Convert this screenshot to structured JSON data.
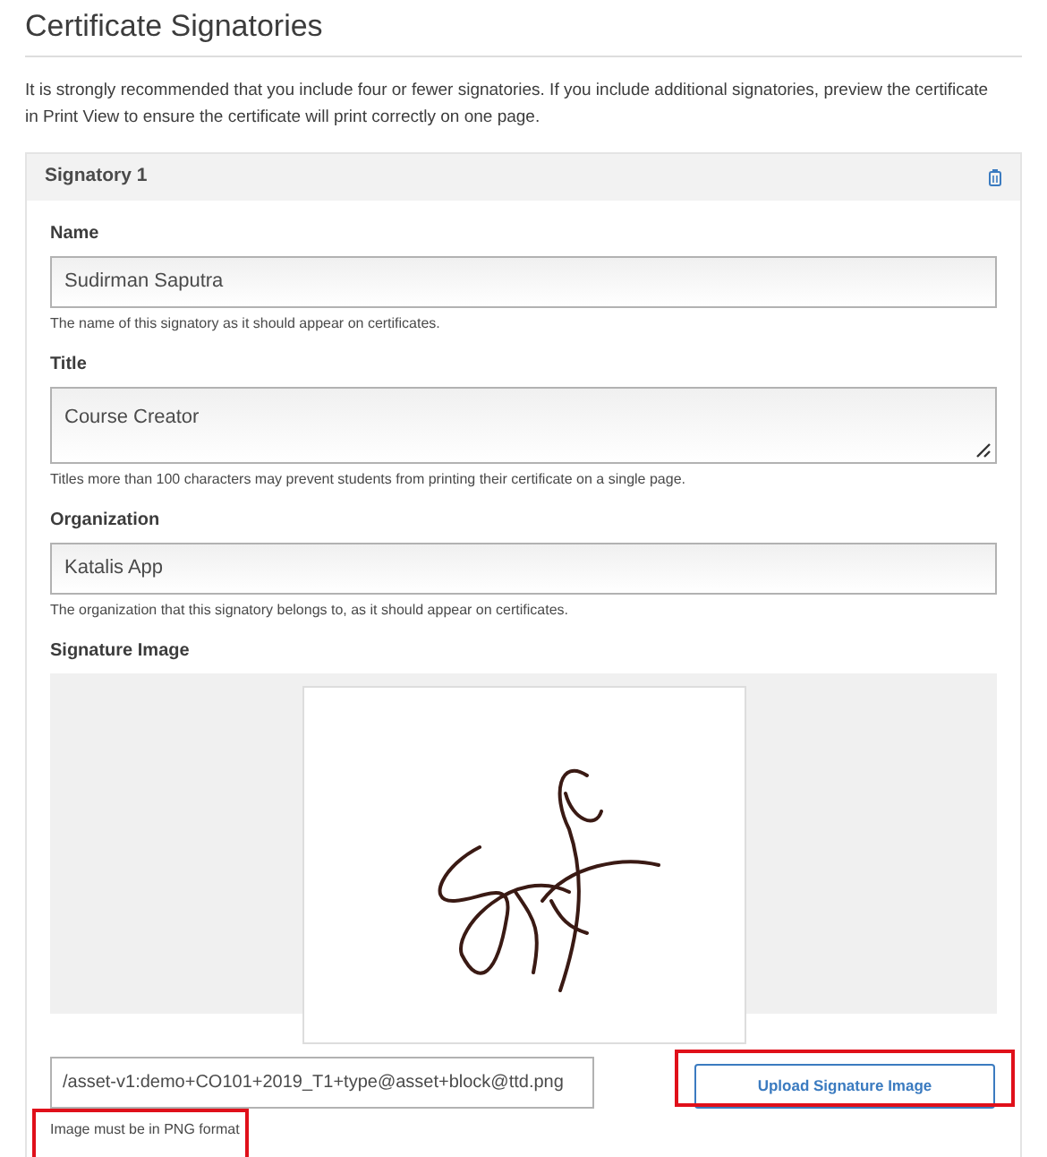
{
  "heading": "Certificate Signatories",
  "intro": "It is strongly recommended that you include four or fewer signatories. If you include additional signatories, preview the certificate in Print View to ensure the certificate will print correctly on one page.",
  "signatory": {
    "title": "Signatory 1",
    "fields": [
      {
        "kind": "input",
        "label": "Name",
        "value": "Sudirman Saputra",
        "hint": "The name of this signatory as it should appear on certificates."
      },
      {
        "kind": "textarea",
        "label": "Title",
        "value": "Course Creator",
        "hint": "Titles more than 100 characters may prevent students from printing their certificate on a single page."
      },
      {
        "kind": "input",
        "label": "Organization",
        "value": "Katalis App",
        "hint": "The organization that this signatory belongs to, as it should appear on certificates."
      }
    ],
    "signature_image": {
      "label": "Signature Image",
      "path": "/asset-v1:demo+CO101+2019_T1+type@asset+block@ttd.png",
      "button": "Upload Signature Image",
      "hint": "Image must be in PNG format"
    }
  }
}
